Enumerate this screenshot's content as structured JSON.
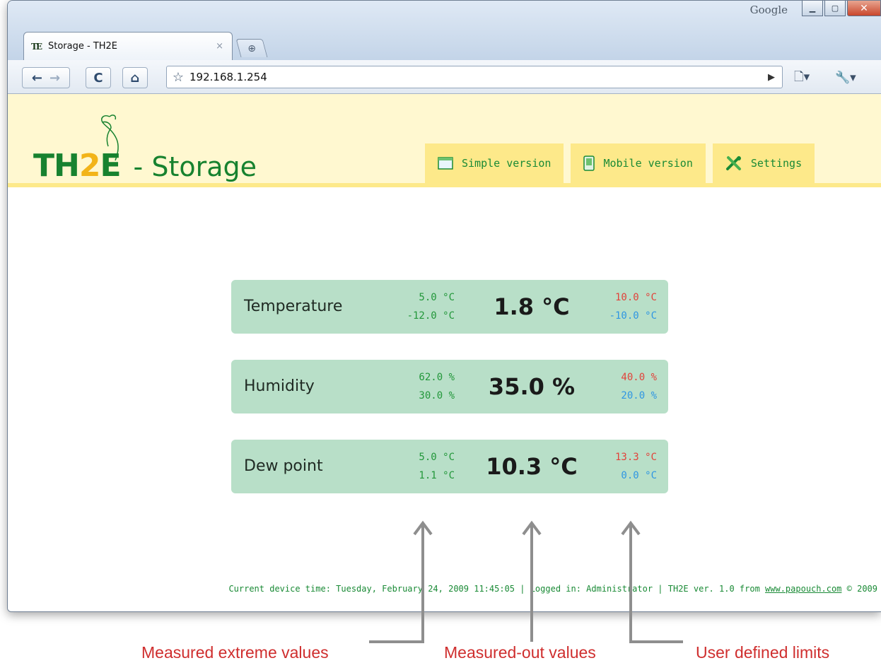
{
  "browser": {
    "search_engine_label": "Google",
    "tab_title": "Storage - TH2E",
    "tab_close": "×",
    "new_tab_icon": "plus-icon",
    "url": "192.168.1.254",
    "icons": [
      "back-icon",
      "forward-icon",
      "reload-icon",
      "home-icon",
      "star-icon",
      "go-icon",
      "page-menu-icon",
      "wrench-icon"
    ]
  },
  "header": {
    "logo": {
      "th": "TH",
      "two": "2",
      "e": "E"
    },
    "subtitle": "- Storage",
    "menu": [
      {
        "label": "Simple version",
        "icon": "window-icon"
      },
      {
        "label": "Mobile version",
        "icon": "mobile-icon"
      },
      {
        "label": "Settings",
        "icon": "tools-icon"
      }
    ]
  },
  "cards": [
    {
      "label": "Temperature",
      "extreme_high": "5.0 °C",
      "extreme_low": "-12.0 °C",
      "value": "1.8 °C",
      "limit_high": "10.0 °C",
      "limit_low": "-10.0 °C"
    },
    {
      "label": "Humidity",
      "extreme_high": "62.0 %",
      "extreme_low": "30.0 %",
      "value": "35.0 %",
      "limit_high": "40.0 %",
      "limit_low": "20.0 %"
    },
    {
      "label": "Dew point",
      "extreme_high": "5.0 °C",
      "extreme_low": "1.1 °C",
      "value": "10.3 °C",
      "limit_high": "13.3 °C",
      "limit_low": "0.0 °C"
    }
  ],
  "footer": {
    "text": "Current device time: Tuesday, February 24, 2009 11:45:05 | Logged in: Administrator | TH2E ver. 1.0 from",
    "link": "www.papouch.com",
    "copyright": "© 2009"
  },
  "annotations": {
    "extreme": "Measured extreme values",
    "measured": "Measured-out values",
    "limits": "User defined limits"
  },
  "colors": {
    "brand_green": "#17822f",
    "header_bg": "#fff8d0",
    "menu_bg": "#fde98a",
    "card_bg": "#b8dfc8",
    "limit_high": "#e2423a",
    "limit_low": "#2f96e3",
    "annotation_red": "#cf2e2e"
  }
}
